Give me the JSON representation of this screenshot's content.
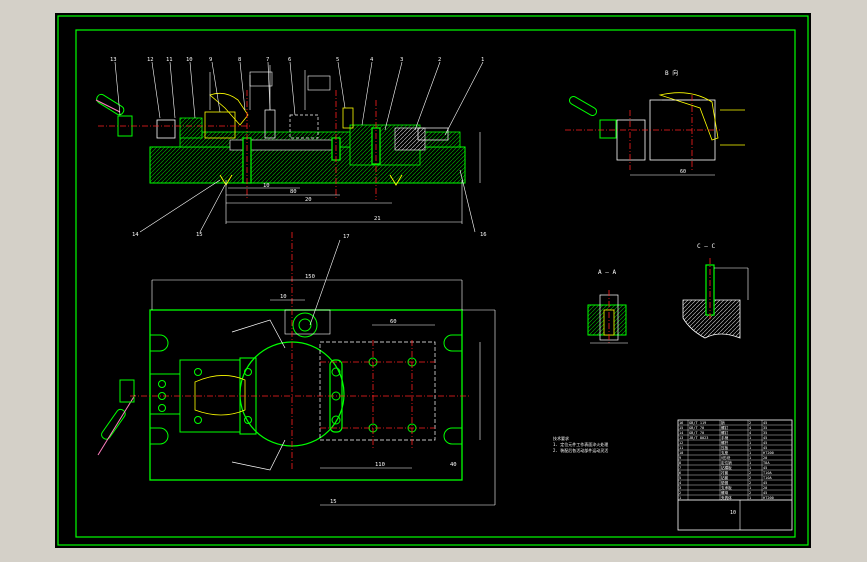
{
  "colors": {
    "window_bg": "#d4d0c8",
    "sheet_bg": "#000000",
    "frame": "#00ff00",
    "white": "#ffffff",
    "center": "#ff2020",
    "yellow": "#ffff00",
    "pink": "#ff7fbf",
    "hatch": "#00cc00"
  },
  "labels": {
    "view_b": "B  向",
    "section_a": "A — A",
    "section_c": "C — C",
    "parts_top": [
      "13",
      "12",
      "11",
      "10",
      "9",
      "8",
      "7",
      "6",
      "5",
      "4",
      "3",
      "2",
      "1"
    ],
    "parts_bottom": [
      "14",
      "15",
      "16"
    ],
    "part_17": "17",
    "dims_front": [
      "10",
      "80",
      "20",
      "21"
    ],
    "dims_plan": [
      "150",
      "10",
      "60",
      "110",
      "15",
      "40"
    ],
    "dim_b_view": "60",
    "tech_notes": [
      "技术要求",
      "1. 定位元件工作表面淬火处理",
      "2. 装配后各活动部件运动灵活"
    ]
  },
  "title_block": {
    "drawing_no": "10",
    "rows": [
      [
        "16",
        "GB/T 119",
        "销",
        "2",
        "45"
      ],
      [
        "15",
        "GB/T 70",
        "螺钉",
        "4",
        "35"
      ],
      [
        "14",
        "GB/T 70",
        "螺钉",
        "4",
        "35"
      ],
      [
        "13",
        "JB/T 8023",
        "手柄",
        "1",
        "45"
      ],
      [
        "12",
        "",
        "螺杆",
        "1",
        "45"
      ],
      [
        "11",
        "",
        "压板",
        "1",
        "45"
      ],
      [
        "10",
        "",
        "支座",
        "1",
        "HT200"
      ],
      [
        "9",
        "",
        "V形块",
        "1",
        "20"
      ],
      [
        "8",
        "",
        "定位销",
        "1",
        "T8A"
      ],
      [
        "7",
        "",
        "钻模板",
        "1",
        "45"
      ],
      [
        "6",
        "",
        "衬套",
        "2",
        "T10A"
      ],
      [
        "5",
        "",
        "钻套",
        "2",
        "T10A"
      ],
      [
        "4",
        "",
        "垫圈",
        "2",
        "45"
      ],
      [
        "3",
        "",
        "支承板",
        "1",
        "20"
      ],
      [
        "2",
        "",
        "螺母",
        "2",
        "45"
      ],
      [
        "1",
        "",
        "夹具体",
        "1",
        "HT200"
      ]
    ]
  }
}
